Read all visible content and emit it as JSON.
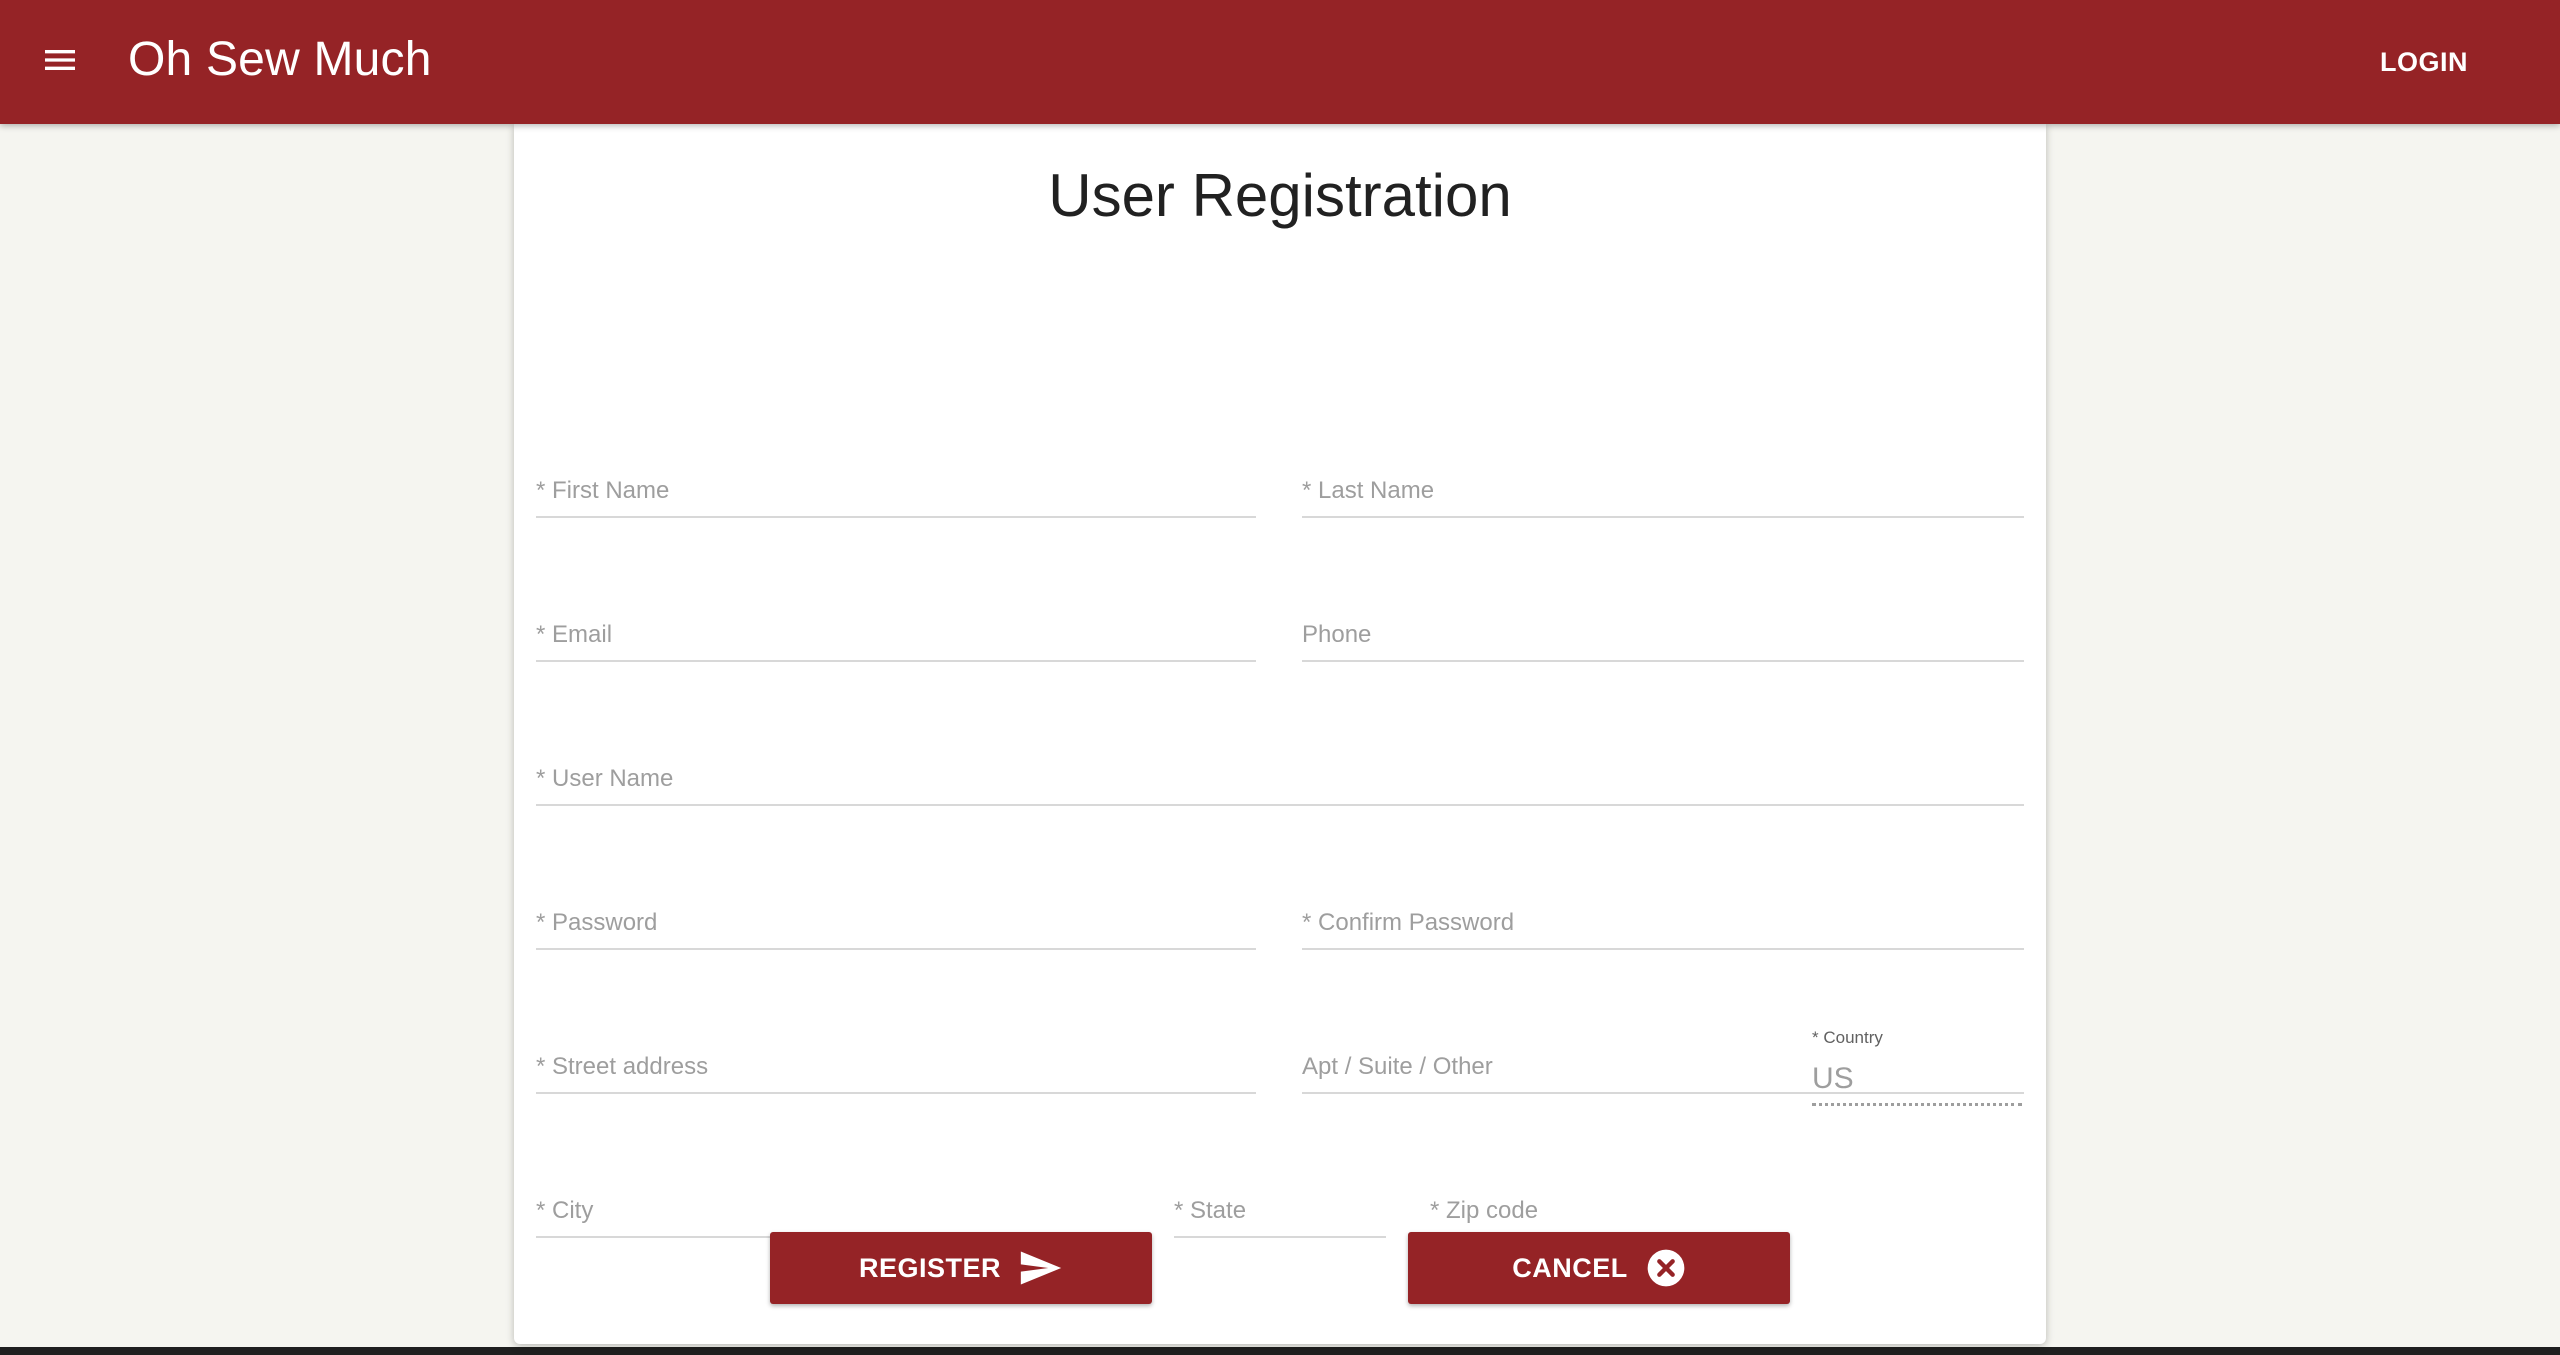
{
  "appbar": {
    "title": "Oh Sew Much",
    "menu_icon": "hamburger-menu-icon",
    "login_label": "LOGIN"
  },
  "form": {
    "title": "User Registration",
    "fields": {
      "first_name": {
        "placeholder": "* First Name",
        "value": ""
      },
      "last_name": {
        "placeholder": "* Last Name",
        "value": ""
      },
      "email": {
        "placeholder": "* Email",
        "value": ""
      },
      "phone": {
        "placeholder": "Phone",
        "value": ""
      },
      "user_name": {
        "placeholder": "* User Name",
        "value": ""
      },
      "password": {
        "placeholder": "* Password",
        "value": ""
      },
      "confirm_password": {
        "placeholder": "* Confirm Password",
        "value": ""
      },
      "street_address": {
        "placeholder": "* Street address",
        "value": ""
      },
      "apt": {
        "placeholder": "Apt / Suite / Other",
        "value": ""
      },
      "city": {
        "placeholder": "* City",
        "value": ""
      },
      "state": {
        "placeholder": "* State",
        "value": ""
      },
      "zip": {
        "placeholder": "* Zip code",
        "value": ""
      }
    },
    "country": {
      "label": "* Country",
      "value": "US"
    },
    "register": {
      "label": "REGISTER",
      "icon": "send-icon"
    },
    "cancel": {
      "label": "CANCEL",
      "icon": "cancel-circle-icon"
    }
  },
  "colors": {
    "primary": "#952326",
    "background": "#f5f5f0",
    "card": "#ffffff",
    "placeholder": "#9e9e9e"
  }
}
